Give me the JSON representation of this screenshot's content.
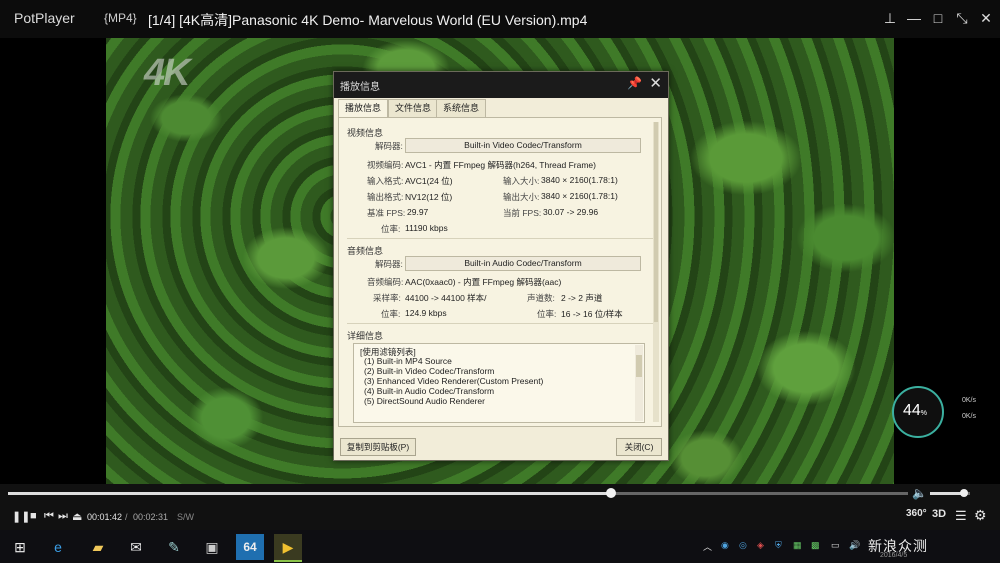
{
  "titlebar": {
    "app": "PotPlayer",
    "format": "{MP4}",
    "file": "[1/4] [4K高清]Panasonic 4K Demo- Marvelous World (EU Version).mp4",
    "buttons": [
      "pin-icon",
      "minimize-icon",
      "maximize-icon",
      "fullscreen-icon",
      "close-icon"
    ]
  },
  "video": {
    "overlay_logo": "4K"
  },
  "dialog": {
    "title": "播放信息",
    "tabs": [
      "播放信息",
      "文件信息",
      "系统信息"
    ],
    "active_tab": 0,
    "video": {
      "section": "视频信息",
      "decoder_label": "解码器:",
      "decoder": "Built-in Video Codec/Transform",
      "codec_label": "视频编码:",
      "codec": "AVC1 - 内置 FFmpeg 解码器(h264, Thread Frame)",
      "in_format_label": "输入格式:",
      "in_format": "AVC1(24 位)",
      "in_size_label": "输入大小:",
      "in_size": "3840 × 2160(1.78:1)",
      "out_format_label": "输出格式:",
      "out_format": "NV12(12 位)",
      "out_size_label": "输出大小:",
      "out_size": "3840 × 2160(1.78:1)",
      "base_fps_label": "基准 FPS:",
      "base_fps": "29.97",
      "cur_fps_label": "当前 FPS:",
      "cur_fps": "30.07 -> 29.96",
      "bitrate_label": "位率:",
      "bitrate": "11190 kbps"
    },
    "audio": {
      "section": "音频信息",
      "decoder_label": "解码器:",
      "decoder": "Built-in Audio Codec/Transform",
      "codec_label": "音频编码:",
      "codec": "AAC(0xaac0) - 内置 FFmpeg 解码器(aac)",
      "sample_label": "采样率:",
      "sample": "44100 -> 44100 样本/",
      "channels_label": "声道数:",
      "channels": "2 -> 2 声道",
      "bitrate_label": "位率:",
      "bitrate": "124.9 kbps",
      "bits_label": "位率:",
      "bits": "16 -> 16 位/样本"
    },
    "detail": {
      "section": "详细信息",
      "items": [
        "[使用滤镜列表]",
        "(1) Built-in MP4 Source",
        "(2) Built-in Video Codec/Transform",
        "(3) Enhanced Video Renderer(Custom Present)",
        "(4) Built-in Audio Codec/Transform",
        "(5) DirectSound Audio Renderer"
      ]
    },
    "copy_button": "复制到剪贴板(P)",
    "close_button": "关闭(C)"
  },
  "overlay": {
    "percent": "44",
    "percent_unit": "%",
    "up_speed": "0K/s",
    "down_speed": "0K/s"
  },
  "controls": {
    "position": 0.67,
    "current_time": "00:01:42",
    "separator": "/",
    "total_time": "00:02:31",
    "sw_label": "S/W",
    "volume": 0.85,
    "btn_360": "360°",
    "btn_3d": "3D"
  },
  "taskbar": {
    "apps": [
      "windows-start-icon",
      "edge-icon",
      "file-explorer-icon",
      "mail-icon",
      "paint-icon",
      "installer-icon",
      "64-app-icon",
      "potplayer-icon"
    ],
    "app_64_label": "64",
    "watermark": "新浪众测",
    "clock_date": "2016/4/5"
  }
}
